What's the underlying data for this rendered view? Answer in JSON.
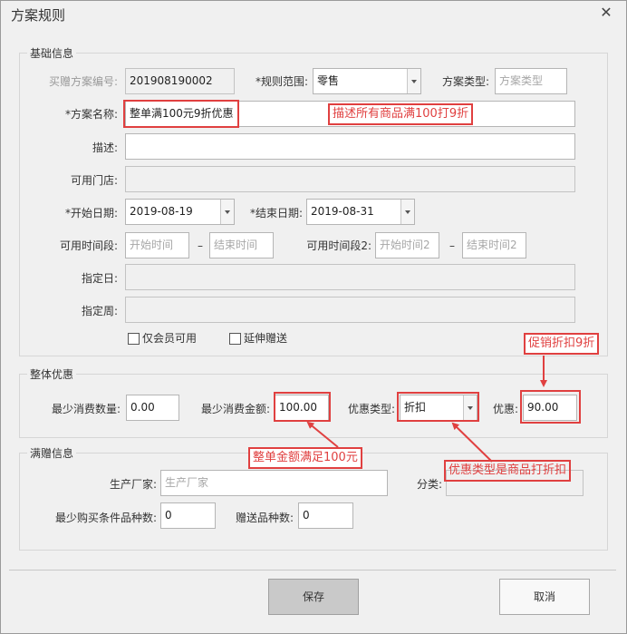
{
  "window": {
    "title": "方案规则",
    "close_glyph": "✕"
  },
  "groups": {
    "basic": "基础信息",
    "overall": "整体优惠",
    "gift": "满赠信息"
  },
  "basic": {
    "plan_no_label": "买赠方案编号:",
    "plan_no_value": "201908190002",
    "scope_label": "*规则范围:",
    "scope_value": "零售",
    "type_label": "方案类型:",
    "type_placeholder": "方案类型",
    "name_label": "*方案名称:",
    "name_value": "整单满100元9折优惠",
    "desc_label": "描述:",
    "desc_value": "",
    "stores_label": "可用门店:",
    "start_date_label": "*开始日期:",
    "start_date_value": "2019-08-19",
    "end_date_label": "*结束日期:",
    "end_date_value": "2019-08-31",
    "period1_label": "可用时间段:",
    "period1_start_ph": "开始时间",
    "period1_end_ph": "结束时间",
    "dash": "–",
    "period2_label": "可用时间段2:",
    "period2_start_ph": "开始时间2",
    "period2_end_ph": "结束时间2",
    "day_label": "指定日:",
    "week_label": "指定周:",
    "member_only_label": "仅会员可用",
    "extend_gift_label": "延伸赠送"
  },
  "overall": {
    "min_qty_label": "最少消费数量:",
    "min_qty_value": "0.00",
    "min_amount_label": "最少消费金额:",
    "min_amount_value": "100.00",
    "discount_type_label": "优惠类型:",
    "discount_type_value": "折扣",
    "discount_label": "优惠:",
    "discount_value": "90.00"
  },
  "gift": {
    "maker_label": "生产厂家:",
    "maker_placeholder": "生产厂家",
    "category_label": "分类:",
    "min_kinds_label": "最少购买条件品种数:",
    "min_kinds_value": "0",
    "gift_kinds_label": "赠送品种数:",
    "gift_kinds_value": "0"
  },
  "annotations": {
    "desc_note": "描述所有商品满100打9折",
    "discount_note": "促销折扣9折",
    "amount_note": "整单金额满足100元",
    "type_note": "优惠类型是商品打折扣",
    "color": "#e04040"
  },
  "buttons": {
    "save": "保存",
    "cancel": "取消"
  }
}
